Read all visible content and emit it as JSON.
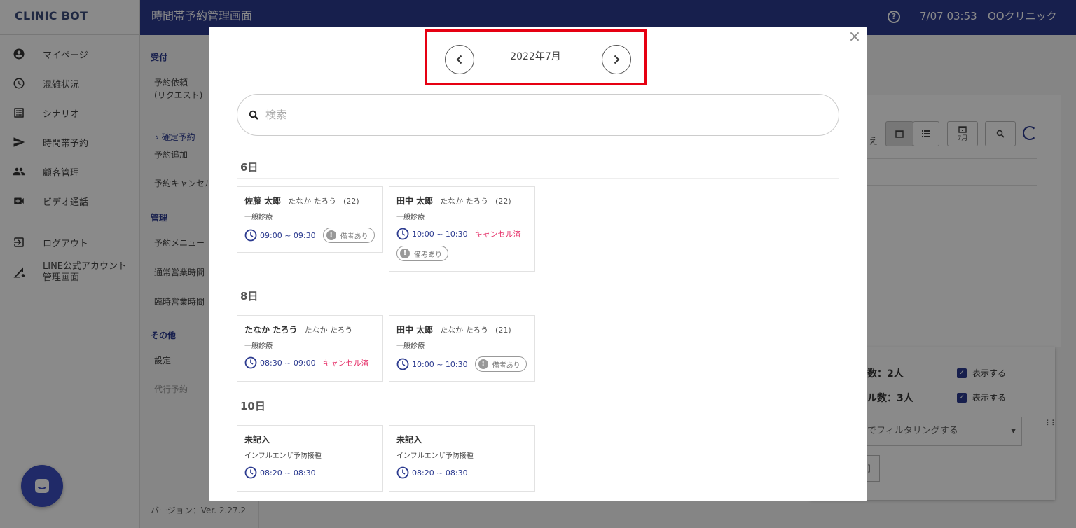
{
  "app": {
    "brand": "CLINIC BOT",
    "version": "バージョン：Ver. 2.27.2"
  },
  "sidebar": {
    "items": [
      {
        "label": "マイページ",
        "icon": "account-circle-icon"
      },
      {
        "label": "混雑状況",
        "icon": "clock-icon"
      },
      {
        "label": "シナリオ",
        "icon": "list-icon"
      },
      {
        "label": "時間帯予約",
        "icon": "send-icon"
      },
      {
        "label": "顧客管理",
        "icon": "people-icon"
      },
      {
        "label": "ビデオ通話",
        "icon": "video-icon"
      }
    ],
    "bottom_items": [
      {
        "label": "ログアウト",
        "icon": "logout-icon"
      },
      {
        "label": "LINE公式アカウント\n管理画面",
        "icon": "signal-settings-icon"
      }
    ]
  },
  "header": {
    "title": "時間帯予約管理画面",
    "help": "?",
    "clock": "7/07 03:53",
    "clinic": "OOクリニック"
  },
  "submenu": {
    "reception": {
      "heading": "受付",
      "items": [
        "予約依頼\n(リクエスト)",
        "確定予約",
        "予約追加",
        "予約キャンセル"
      ]
    },
    "management": {
      "heading": "管理",
      "items": [
        "予約メニュー",
        "通常営業時間",
        "臨時営業時間"
      ]
    },
    "other": {
      "heading": "その他",
      "items": [
        "設定",
        "代行予約"
      ]
    }
  },
  "background": {
    "toolbar_label": "え",
    "month_btn": "7月",
    "stat1": "数：2人",
    "stat2": "ル数：3人",
    "show_label": "表示する",
    "filter_placeholder": "でフィルタリングする",
    "button_fragment": "]"
  },
  "modal": {
    "month": "2022年7月",
    "search_placeholder": "検索",
    "days": [
      {
        "heading": "6日",
        "cards": [
          {
            "name": "佐藤 太郎",
            "kana": "たなか たろう",
            "age": "(22)",
            "menu": "一般診療",
            "time": "09:00 ~ 09:30",
            "cancelled": "",
            "note": "備考あり"
          },
          {
            "name": "田中 太郎",
            "kana": "たなか たろう",
            "age": "(22)",
            "menu": "一般診療",
            "time": "10:00 ~ 10:30",
            "cancelled": "キャンセル済",
            "note": "備考あり"
          }
        ]
      },
      {
        "heading": "8日",
        "cards": [
          {
            "name": "たなか たろう",
            "kana": "たなか たろう",
            "age": "",
            "menu": "一般診療",
            "time": "08:30 ~ 09:00",
            "cancelled": "キャンセル済",
            "note": ""
          },
          {
            "name": "田中 太郎",
            "kana": "たなか たろう",
            "age": "(21)",
            "menu": "一般診療",
            "time": "10:00 ~ 10:30",
            "cancelled": "",
            "note": "備考あり"
          }
        ]
      },
      {
        "heading": "10日",
        "cards": [
          {
            "name": "未記入",
            "kana": "",
            "age": "",
            "menu": "インフルエンザ予防接種",
            "time": "08:20 ~ 08:30",
            "cancelled": "",
            "note": ""
          },
          {
            "name": "未記入",
            "kana": "",
            "age": "",
            "menu": "インフルエンザ予防接種",
            "time": "08:20 ~ 08:30",
            "cancelled": "",
            "note": ""
          }
        ]
      }
    ]
  },
  "colors": {
    "primary": "#2b3a8f",
    "highlight": "#e60012",
    "cancel": "#e6336b"
  }
}
